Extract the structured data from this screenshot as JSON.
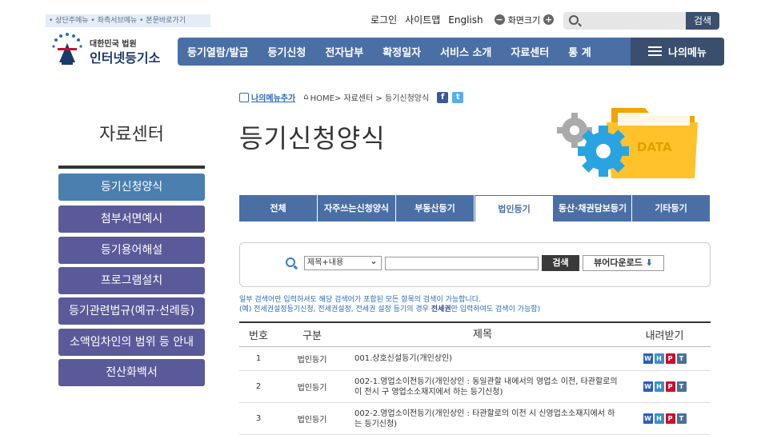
{
  "skip_links": "• 상단주메뉴 • 좌측서브메뉴 • 본문바로가기",
  "util": {
    "login": "로그인",
    "sitemap": "사이트맵",
    "english": "English",
    "zoom_label": "화면크기",
    "zoom_minus": "−",
    "zoom_plus": "+"
  },
  "search": {
    "button": "검색"
  },
  "logo": {
    "line1": "대한민국 법원",
    "line2": "인터넷등기소"
  },
  "gnb": [
    "등기열람/발급",
    "등기신청",
    "전자납부",
    "확정일자",
    "서비스 소개",
    "자료센터",
    "통 계"
  ],
  "my_menu": "나의메뉴",
  "sidebar": {
    "title": "자료센터",
    "items": [
      "등기신청양식",
      "첨부서면예시",
      "등기용어해설",
      "프로그램설치",
      "등기관련법규(예규·선례등)",
      "소액임차인의 범위 등 안내",
      "전산화백서"
    ]
  },
  "breadcrumb": {
    "add": "나의메뉴추가",
    "path": "HOME> 자료센터 > 등기신청양식",
    "facebook": "f",
    "twitter": "t"
  },
  "page_title": "등기신청양식",
  "illustration": {
    "label": "DATA"
  },
  "tabs": [
    "전체",
    "자주쓰는신청양식",
    "부동산등기",
    "법인등기",
    "동산·채권담보등기",
    "기타등기"
  ],
  "active_tab": 3,
  "filter": {
    "select_value": "제목+내용",
    "search_button": "검색",
    "viewer_button": "뷰어다운로드"
  },
  "notes": {
    "line1": "일부 검색어만 입력하셔도 해당 검색어가 포함된 모든 항목의 검색이 가능합니다.",
    "line2a": "(예) 전세권설정등기신청, 전세권설정, 전세권 설정 등기의 경우 ",
    "line2b": "전세권",
    "line2c": "만 입력하여도 검색이 가능함)"
  },
  "table": {
    "headers": [
      "번호",
      "구분",
      "제목",
      "내려받기"
    ],
    "rows": [
      {
        "no": "1",
        "type": "법인등기",
        "title": "001.상호신설등기(개인상인)"
      },
      {
        "no": "2",
        "type": "법인등기",
        "title": "002-1.영업소이전등기(개인상인 : 동일관할 내에서의 영업소 이전, 타관할로의 이 전시 구 영업소소재지에서 하는 등기신청)"
      },
      {
        "no": "3",
        "type": "법인등기",
        "title": "002-2.영업소이전등기(개인상인 : 타관할로의 이전 시 신영업소소재지에서 하는 등기신청)"
      }
    ],
    "file_icons": [
      "W",
      "H",
      "P",
      "T"
    ]
  },
  "colors": {
    "nav": "#4a6fa5",
    "sidebar": "#5a5a9a",
    "sidebar_active": "#4a7fb0",
    "link": "#2a6bb6"
  }
}
